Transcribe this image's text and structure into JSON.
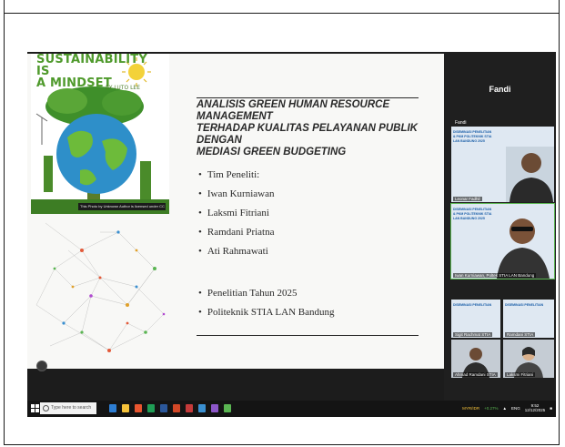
{
  "slide": {
    "poster": {
      "title_line1": "SUSTAINABILITY IS",
      "title_line2": "A MINDSET",
      "by": "BY LUTO LEE",
      "credit": "This Photo by Unknown Author is licensed under CC BY-SA-NC"
    },
    "title": {
      "line1": "ANALISIS GREEN HUMAN RESOURCE MANAGEMENT",
      "line2": "TERHADAP KUALITAS PELAYANAN PUBLIK DENGAN",
      "line3": "MEDIASI GREEN BUDGETING"
    },
    "team_bullets": [
      "Tim Peneliti:",
      "Iwan Kurniawan",
      "Laksmi Fitriani",
      "Ramdani Priatna",
      "Ati Rahmawati"
    ],
    "info_bullets": [
      "Penelitian Tahun 2025",
      "Politeknik STIA LAN Bandung"
    ]
  },
  "participants": {
    "speaker_name": "Fandi",
    "self_label": "Fandi",
    "tiles": [
      {
        "name": "Leonar Fadhil",
        "slide_title": "DISEMINASI PENELITIAN & PKM POLITEKNIK STIA LAN BANDUNG 2025"
      },
      {
        "name": "Iwan Kurniawan, Poltek STIA LAN Bandung",
        "slide_title": "DISEMINASI PENELITIAN & PKM POLITEKNIK STIA LAN BANDUNG 2025"
      },
      {
        "name": "Sigit Rachmat STIA",
        "slide_title": "DISEMINASI PENELITIAN"
      },
      {
        "name": "Ramdani STIA",
        "slide_title": "DISEMINASI PENELITIAN"
      },
      {
        "name": "Ahmad Ramdani STIA",
        "slide_title": ""
      },
      {
        "name": "Laksmi Fitriani",
        "slide_title": ""
      }
    ]
  },
  "taskbar": {
    "search_placeholder": "Type here to search",
    "weather": "MYR/IDR",
    "weather_change": "+0.27%",
    "lang": "ENG",
    "time": "9:52",
    "date": "12/12/2025"
  },
  "colors": {
    "accent_green": "#5ab552",
    "slide_bg": "#f8f8f6",
    "meeting_bg": "#1c1c1c"
  }
}
